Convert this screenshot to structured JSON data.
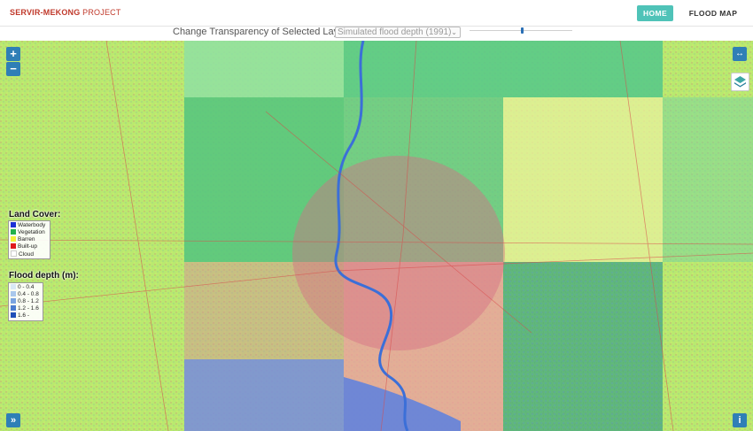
{
  "header": {
    "brand_bold": "SERVIR-MEKONG",
    "brand_light": "PROJECT",
    "nav": [
      {
        "label": "HOME",
        "active": true
      },
      {
        "label": "FLOOD MAP",
        "active": false
      }
    ]
  },
  "transparency": {
    "label": "Change Transparency of Selected Layer:",
    "selected_layer": "Simulated flood depth (1991)",
    "slider_value_fraction": 0.5
  },
  "map_controls": {
    "zoom_in": "+",
    "zoom_out": "−",
    "fullscreen": "↔",
    "expand": "»",
    "info": "i"
  },
  "legend_landcover": {
    "title": "Land Cover:",
    "items": [
      {
        "label": "Waterbody",
        "color": "#1c2fd6"
      },
      {
        "label": "Vegetation",
        "color": "#22b14c"
      },
      {
        "label": "Barren",
        "color": "#f2f23a"
      },
      {
        "label": "Built-up",
        "color": "#e0191c"
      },
      {
        "label": "Cloud",
        "color": "#ffffff"
      }
    ]
  },
  "legend_flood": {
    "title": "Flood depth (m):",
    "items": [
      {
        "label": "0 - 0.4",
        "color": "#d8e8f6"
      },
      {
        "label": "0.4 - 0.8",
        "color": "#a9c8ec"
      },
      {
        "label": "0.8 - 1.2",
        "color": "#7aa4e0"
      },
      {
        "label": "1.2 - 1.6",
        "color": "#4a7ccf"
      },
      {
        "label": "1.6 -",
        "color": "#1f4fb8"
      }
    ]
  },
  "colors": {
    "accent": "#4fc3b8",
    "brand": "#c0392b",
    "control_blue": "#2f7fb6"
  }
}
